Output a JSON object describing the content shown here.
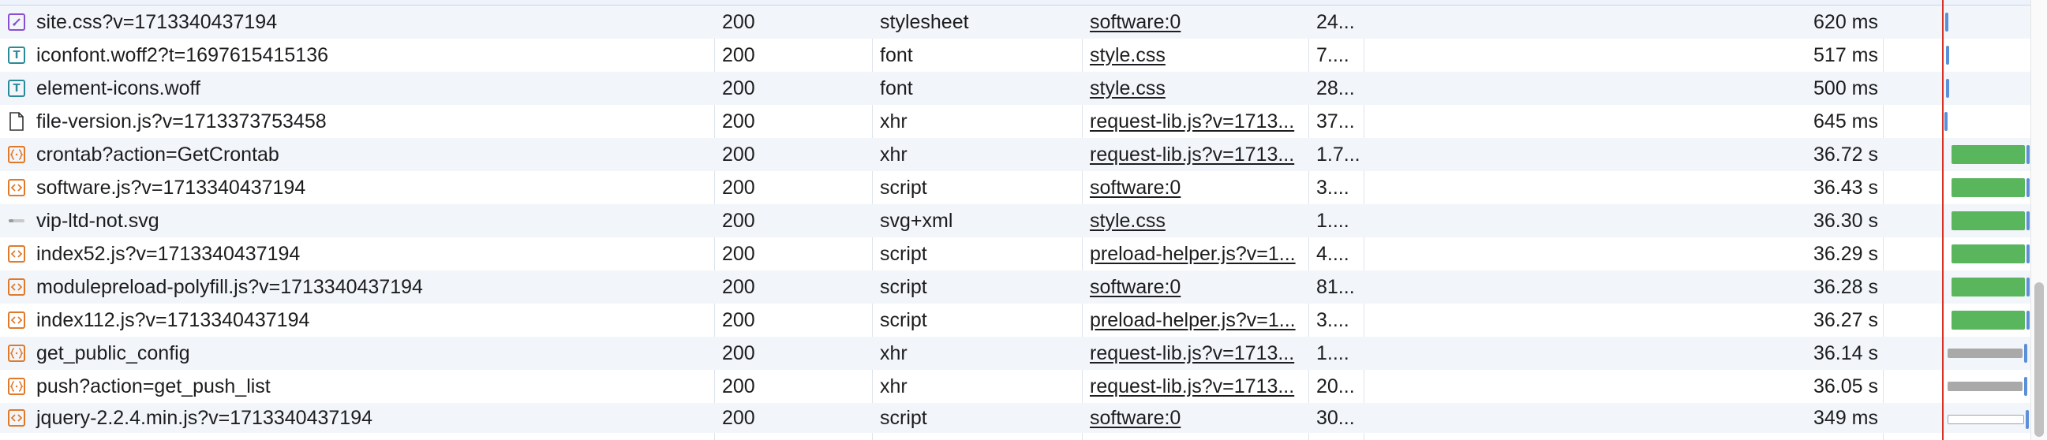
{
  "colors": {
    "row_alt": "#f2f5f9",
    "script_icon": "#e07a2a",
    "css_icon": "#8a4fd0",
    "font_icon": "#2b8a9a",
    "bar_green": "#5ab65d",
    "bar_blue": "#5b8fd8",
    "bar_gray": "#a9a9a9",
    "timeline_marker": "#d93025"
  },
  "rows": [
    {
      "name": "site.css?v=1713340437194",
      "status": "200",
      "type": "stylesheet",
      "initiator": "software:0",
      "size": "24...",
      "time": "620 ms",
      "icon": "css-file-icon"
    },
    {
      "name": "iconfont.woff2?t=1697615415136",
      "status": "200",
      "type": "font",
      "initiator": "style.css",
      "size": "7....",
      "time": "517 ms",
      "icon": "font-file-icon"
    },
    {
      "name": "element-icons.woff",
      "status": "200",
      "type": "font",
      "initiator": "style.css",
      "size": "28...",
      "time": "500 ms",
      "icon": "font-file-icon"
    },
    {
      "name": "file-version.js?v=1713373753458",
      "status": "200",
      "type": "xhr",
      "initiator": "request-lib.js?v=1713...",
      "size": "37...",
      "time": "645 ms",
      "icon": "document-icon"
    },
    {
      "name": "crontab?action=GetCrontab",
      "status": "200",
      "type": "xhr",
      "initiator": "request-lib.js?v=1713...",
      "size": "1.7...",
      "time": "36.72 s",
      "icon": "json-braces-icon"
    },
    {
      "name": "software.js?v=1713340437194",
      "status": "200",
      "type": "script",
      "initiator": "software:0",
      "size": "3....",
      "time": "36.43 s",
      "icon": "script-icon"
    },
    {
      "name": "vip-ltd-not.svg",
      "status": "200",
      "type": "svg+xml",
      "initiator": "style.css",
      "size": "1....",
      "time": "36.30 s",
      "icon": "image-thumbnail-icon"
    },
    {
      "name": "index52.js?v=1713340437194",
      "status": "200",
      "type": "script",
      "initiator": "preload-helper.js?v=1...",
      "size": "4....",
      "time": "36.29 s",
      "icon": "script-icon"
    },
    {
      "name": "modulepreload-polyfill.js?v=1713340437194",
      "status": "200",
      "type": "script",
      "initiator": "software:0",
      "size": "81...",
      "time": "36.28 s",
      "icon": "script-icon"
    },
    {
      "name": "index112.js?v=1713340437194",
      "status": "200",
      "type": "script",
      "initiator": "preload-helper.js?v=1...",
      "size": "3....",
      "time": "36.27 s",
      "icon": "script-icon"
    },
    {
      "name": "get_public_config",
      "status": "200",
      "type": "xhr",
      "initiator": "request-lib.js?v=1713...",
      "size": "1....",
      "time": "36.14 s",
      "icon": "json-braces-icon"
    },
    {
      "name": "push?action=get_push_list",
      "status": "200",
      "type": "xhr",
      "initiator": "request-lib.js?v=1713...",
      "size": "20...",
      "time": "36.05 s",
      "icon": "json-braces-icon"
    },
    {
      "name": "jquery-2.2.4.min.js?v=1713340437194",
      "status": "200",
      "type": "script",
      "initiator": "software:0",
      "size": "30...",
      "time": "349 ms",
      "icon": "script-icon"
    }
  ],
  "waterfall": [
    {
      "kind": "tick",
      "start": 0.02,
      "width": 0.0
    },
    {
      "kind": "tick",
      "start": 0.03,
      "width": 0.0
    },
    {
      "kind": "tick",
      "start": 0.03,
      "width": 0.0
    },
    {
      "kind": "tick",
      "start": 0.01,
      "width": 0.0
    },
    {
      "kind": "green",
      "start": 0.09,
      "width": 0.86
    },
    {
      "kind": "green",
      "start": 0.09,
      "width": 0.86
    },
    {
      "kind": "green",
      "start": 0.09,
      "width": 0.86
    },
    {
      "kind": "green",
      "start": 0.09,
      "width": 0.86
    },
    {
      "kind": "green",
      "start": 0.09,
      "width": 0.86
    },
    {
      "kind": "green",
      "start": 0.09,
      "width": 0.86
    },
    {
      "kind": "gray",
      "start": 0.05,
      "width": 0.88
    },
    {
      "kind": "gray",
      "start": 0.05,
      "width": 0.88
    },
    {
      "kind": "hollow",
      "start": 0.05,
      "width": 0.9
    }
  ]
}
